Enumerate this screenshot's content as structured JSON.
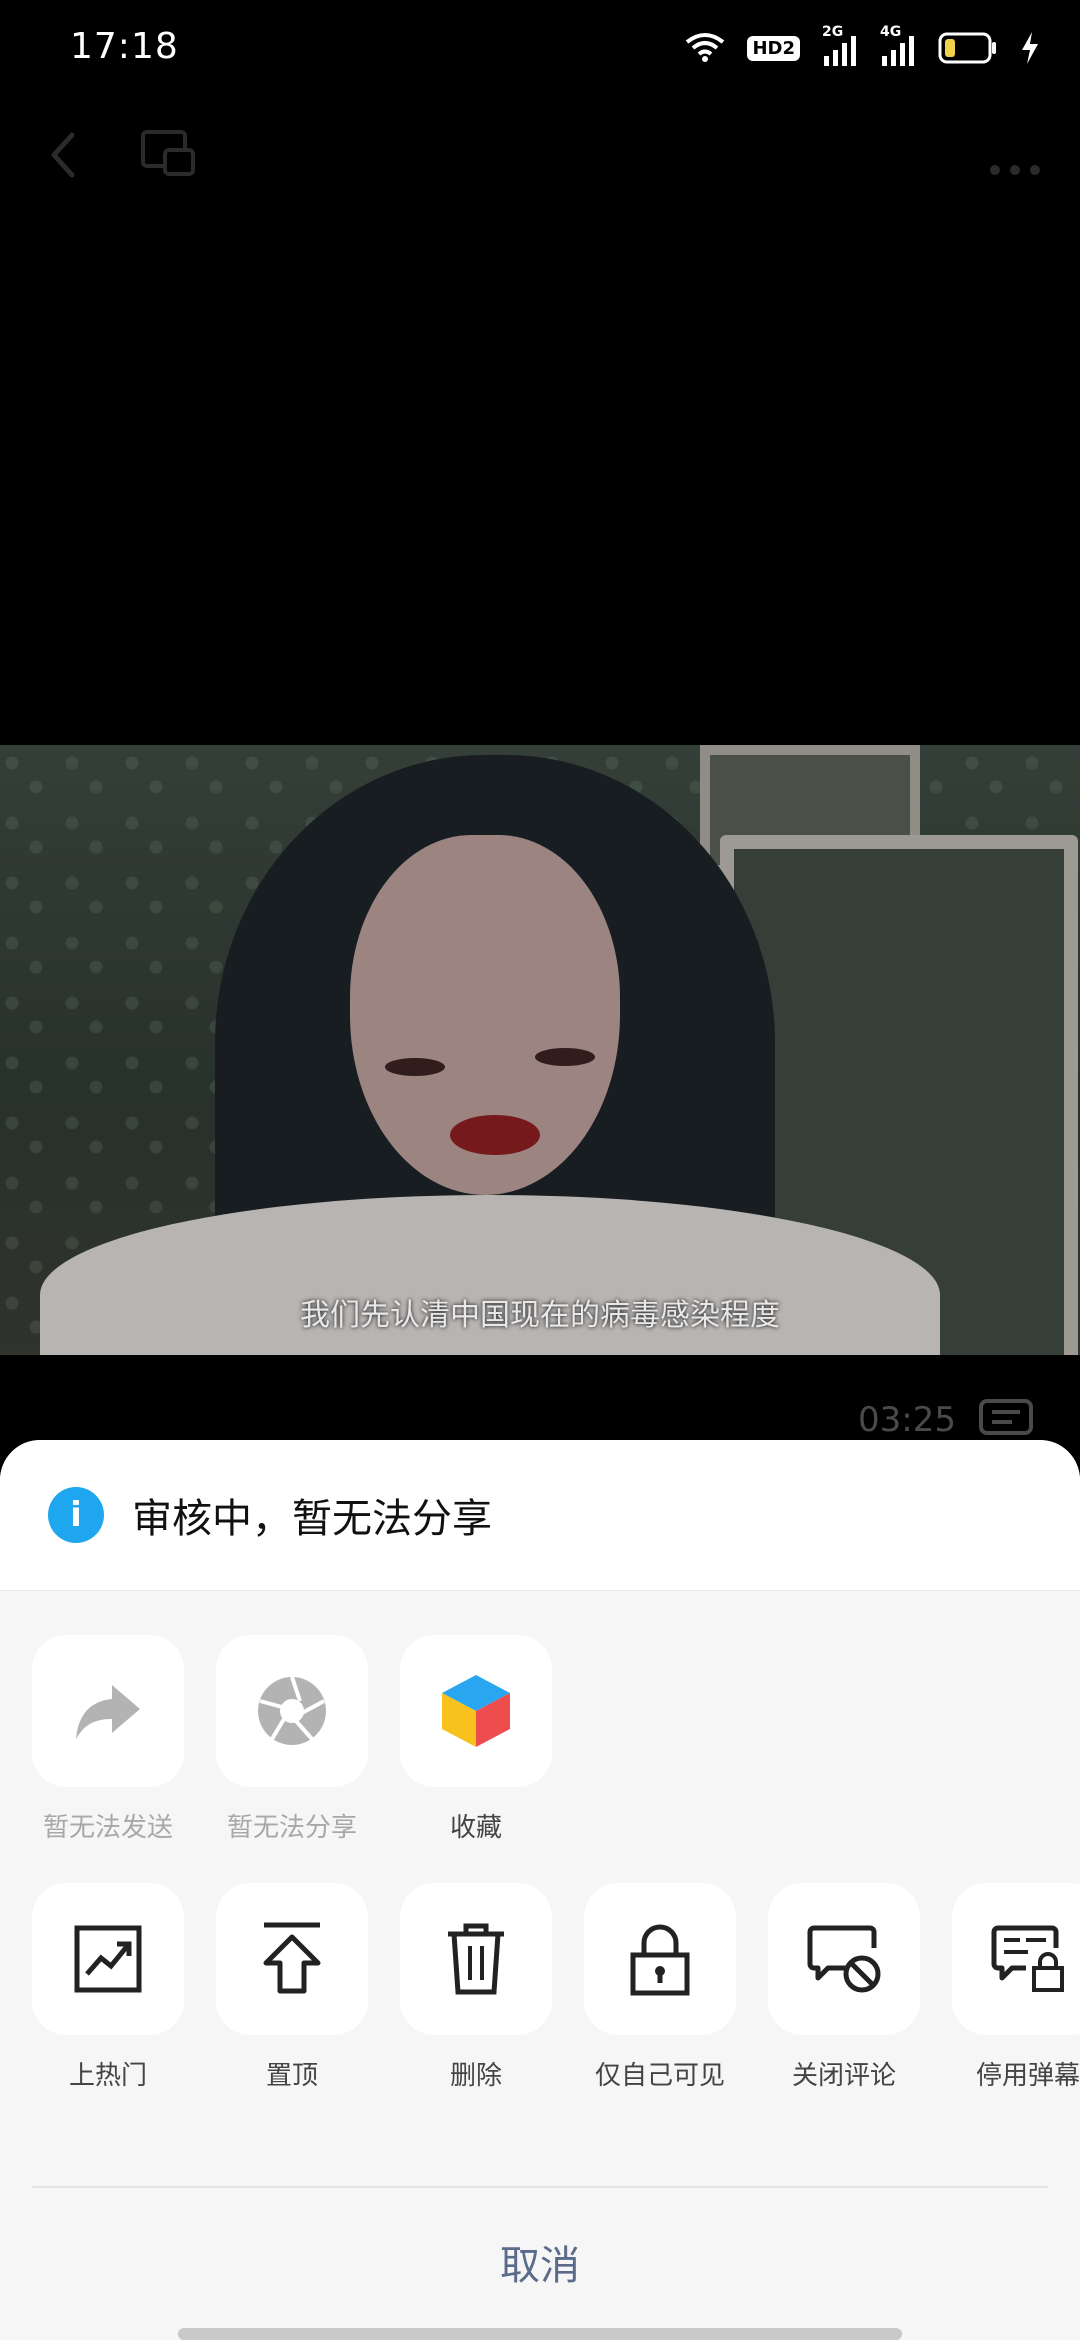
{
  "status_bar": {
    "time": "17:18",
    "hd_label": "HD2",
    "net1_label": "2G",
    "net2_label": "4G"
  },
  "video": {
    "subtitle": "我们先认清中国现在的病毒感染程度",
    "duration": "03:25"
  },
  "sheet": {
    "title": "审核中，暂无法分享",
    "row1": [
      {
        "label": "暂无法发送",
        "icon": "forward-icon",
        "disabled": true
      },
      {
        "label": "暂无法分享",
        "icon": "aperture-icon",
        "disabled": true
      },
      {
        "label": "收藏",
        "icon": "cube-icon",
        "disabled": false
      }
    ],
    "row2": [
      {
        "label": "上热门",
        "icon": "trending-icon"
      },
      {
        "label": "置顶",
        "icon": "pin-top-icon"
      },
      {
        "label": "删除",
        "icon": "trash-icon"
      },
      {
        "label": "仅自己可见",
        "icon": "lock-icon"
      },
      {
        "label": "关闭评论",
        "icon": "comment-off-icon"
      },
      {
        "label": "停用弹幕",
        "icon": "danmaku-lock-icon"
      }
    ],
    "cancel_label": "取消"
  },
  "colors": {
    "info_blue": "#1ea7ef",
    "cancel_text": "#5b6c8a"
  }
}
